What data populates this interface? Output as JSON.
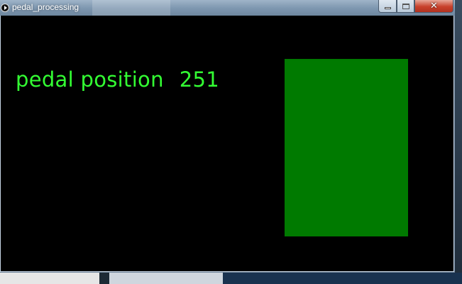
{
  "window": {
    "title": "pedal_processing",
    "close_label": "✕"
  },
  "sketch": {
    "label": "pedal position",
    "value": "251",
    "text_color": "#33ff33",
    "bar_color": "#007a00",
    "background": "#000000"
  }
}
